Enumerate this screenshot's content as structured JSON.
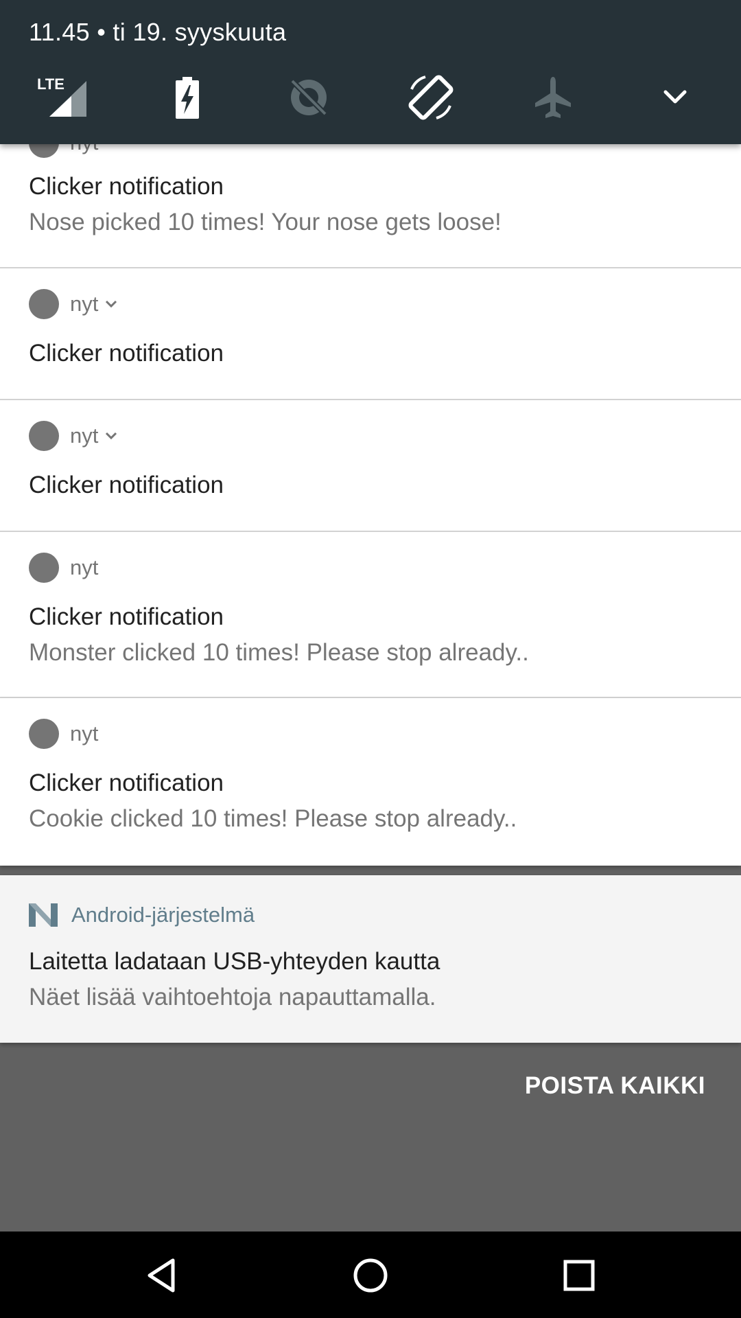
{
  "status": {
    "datetime": "11.45 • ti 19. syyskuuta"
  },
  "quick_settings": {
    "tiles": [
      {
        "icon": "lte-signal-icon",
        "label": "LTE"
      },
      {
        "icon": "battery-charging-icon"
      },
      {
        "icon": "data-saver-off-icon"
      },
      {
        "icon": "auto-rotate-icon"
      },
      {
        "icon": "airplane-mode-icon"
      },
      {
        "icon": "expand-chevron-icon"
      }
    ],
    "colors": {
      "background": "#263238",
      "active": "#ffffff",
      "inactive": "#6d7b80"
    }
  },
  "notifications": [
    {
      "time": "nyt",
      "title": "Clicker notification",
      "text": "Nose picked 10 times! Your nose gets loose!"
    },
    {
      "time": "nyt",
      "title": "Clicker notification",
      "text": ""
    },
    {
      "time": "nyt",
      "title": "Clicker notification",
      "text": ""
    },
    {
      "time": "nyt",
      "title": "Clicker notification",
      "text": "Monster clicked 10 times! Please stop already.."
    },
    {
      "time": "nyt",
      "title": "Clicker notification",
      "text": "Cookie clicked 10 times! Please stop already.."
    }
  ],
  "system_notification": {
    "app": "Android-järjestelmä",
    "title": "Laitetta ladataan USB-yhteyden kautta",
    "text": "Näet lisää vaihtoehtoja napauttamalla."
  },
  "clear_all_label": "POISTA KAIKKI",
  "nav": {
    "buttons": [
      {
        "icon": "back-icon"
      },
      {
        "icon": "home-icon"
      },
      {
        "icon": "recents-icon"
      }
    ]
  }
}
